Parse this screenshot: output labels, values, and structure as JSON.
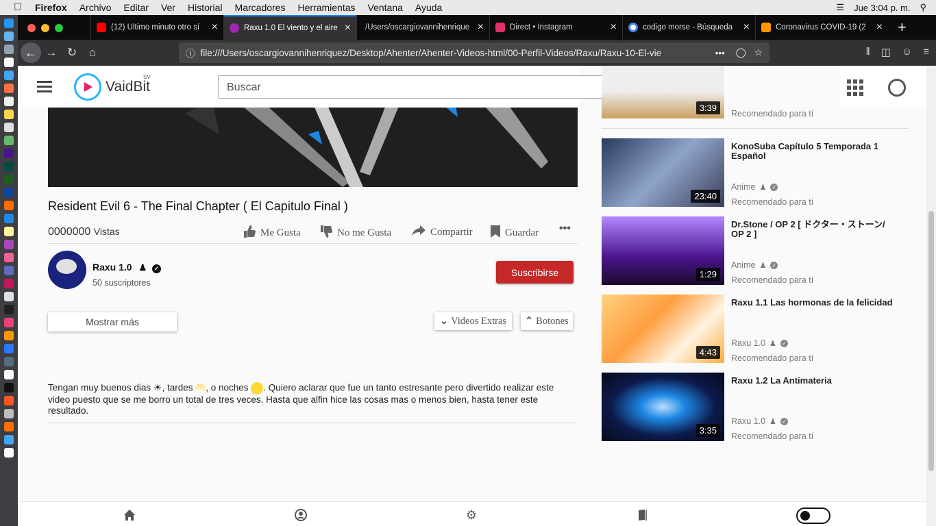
{
  "menubar": {
    "apple": "",
    "app": "Firefox",
    "items": [
      "Archivo",
      "Editar",
      "Ver",
      "Historial",
      "Marcadores",
      "Herramientas",
      "Ventana",
      "Ayuda"
    ],
    "clock": "Jue 3:04 p. m."
  },
  "tabs": [
    {
      "title": "(12) Último minuto otro sí",
      "color": "#ff0000"
    },
    {
      "title": "Raxu 1.0 El viento y el aire",
      "color": "#9c27b0"
    },
    {
      "title": "/Users/oscargiovannihenrique",
      "color": ""
    },
    {
      "title": "Direct • Instagram",
      "color": "#e1306c"
    },
    {
      "title": "codigo morse - Búsqueda",
      "color": "#4285f4"
    },
    {
      "title": "Coronavirus COVID-19 (2",
      "color": "#ff9800"
    }
  ],
  "url": "file:///Users/oscargiovannihenriquez/Desktop/Ahenter/Ahenter-Videos-html/00-Perfil-Videos/Raxu/Raxu-10-El-vie",
  "header": {
    "logo": "VaidBit",
    "logo_sup": "SV",
    "search_placeholder": "Buscar"
  },
  "video": {
    "title": "Resident Evil 6 - The Final Chapter ( El Capitulo Final )",
    "views": "0000000",
    "views_label": "Vistas",
    "like": "Me  Gusta",
    "dislike": "No  me  Gusta",
    "share": "Compartir",
    "save": "Guardar",
    "more": "•••"
  },
  "channel": {
    "name": "Raxu 1.0",
    "subs": "50 suscriptores",
    "subscribe": "Suscribirse"
  },
  "controls": {
    "show_more": "Mostrar más",
    "extras": "Videos  Extras",
    "buttons": "Botones"
  },
  "description": {
    "p1": "Tengan muy buenos dias",
    "p2": ", tardes",
    "p3": ", o noches",
    "p4": ". Quiero aclarar que fue un tanto estresante pero divertido realizar este video puesto que se me borro un total de tres veces. Hasta que alfin hice las cosas mas o menos bien, hasta tener este resultado."
  },
  "sidebar": {
    "top_duration": "3:39",
    "top_reason": "Recomendado para tí",
    "items": [
      {
        "title": "KonoSuba Capítulo 5 Temporada 1 Español",
        "channel": "Anime",
        "duration": "23:40",
        "reason": "Recomendado para tí",
        "bg": "#5b6b8f"
      },
      {
        "title": "Dr.Stone / OP 2 [ ドクター・ストーン/ OP 2 ]",
        "channel": "Anime",
        "duration": "1:29",
        "reason": "Recomendado para tí",
        "bg": "#7b3fa0"
      },
      {
        "title": "Raxu 1.1 Las hormonas de la felicidad",
        "channel": "Raxu 1.0",
        "duration": "4:43",
        "reason": "Recomendado para tí",
        "bg": "#e0a060"
      },
      {
        "title": "Raxu 1.2 La Antimateria",
        "channel": "Raxu 1.0",
        "duration": "3:35",
        "reason": "Recomendado para tí",
        "bg": "#1a3a8a"
      }
    ]
  }
}
